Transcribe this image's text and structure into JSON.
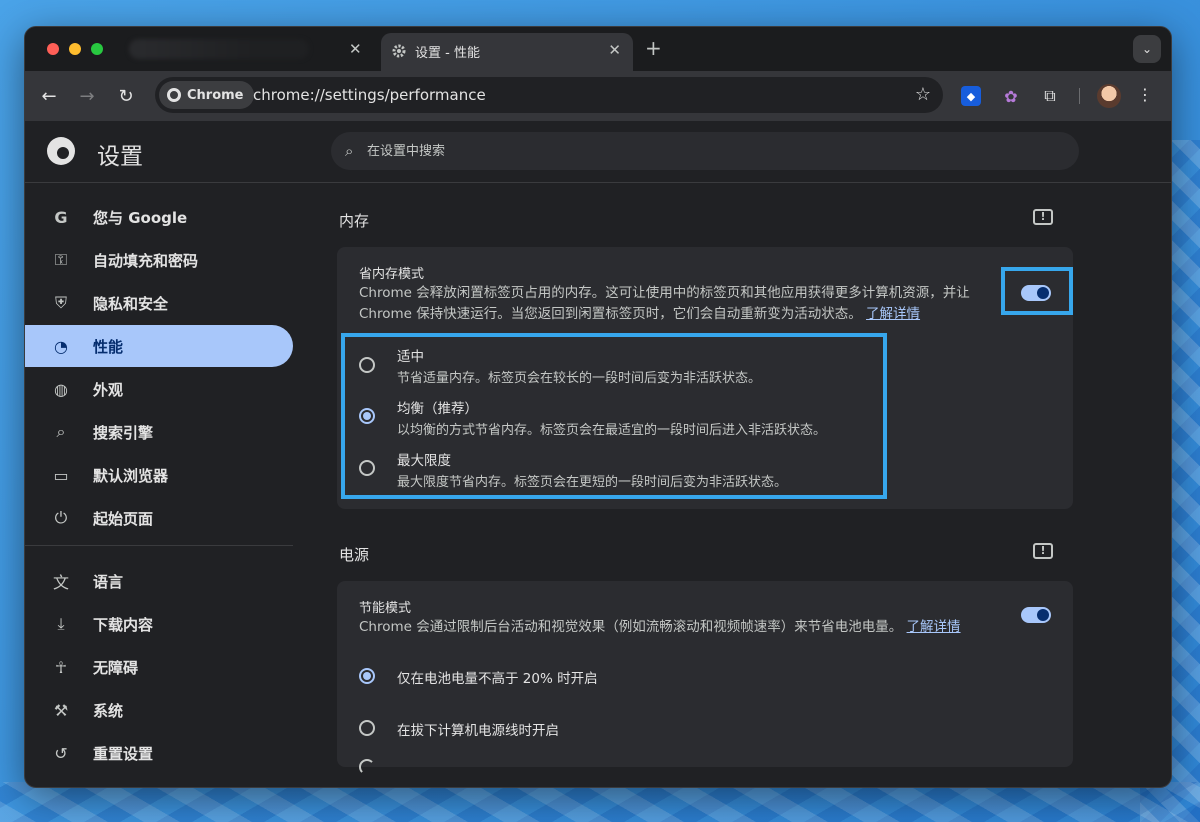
{
  "browser": {
    "active_tab_title": "设置 - 性能",
    "tab_close": "✕",
    "new_tab": "+",
    "tab_menu": "⌄",
    "chip_label": "Chrome",
    "url": "chrome://settings/performance"
  },
  "header": {
    "title": "设置",
    "search_placeholder": "在设置中搜索"
  },
  "sidebar": {
    "items": [
      {
        "label": "您与 Google",
        "icon": "google-icon"
      },
      {
        "label": "自动填充和密码",
        "icon": "key-icon"
      },
      {
        "label": "隐私和安全",
        "icon": "shield-icon"
      },
      {
        "label": "性能",
        "icon": "speedometer-icon",
        "active": true
      },
      {
        "label": "外观",
        "icon": "palette-icon"
      },
      {
        "label": "搜索引擎",
        "icon": "search-icon"
      },
      {
        "label": "默认浏览器",
        "icon": "browser-window-icon"
      },
      {
        "label": "起始页面",
        "icon": "power-icon"
      },
      {
        "label": "语言",
        "icon": "translate-icon"
      },
      {
        "label": "下载内容",
        "icon": "download-icon"
      },
      {
        "label": "无障碍",
        "icon": "accessibility-icon"
      },
      {
        "label": "系统",
        "icon": "wrench-icon"
      },
      {
        "label": "重置设置",
        "icon": "reset-icon"
      }
    ]
  },
  "memory": {
    "section_title": "内存",
    "card_title": "省内存模式",
    "desc_line1": "Chrome 会释放闲置标签页占用的内存。这可让使用中的标签页和其他应用获得更多计算机资源，并让",
    "desc_line2": "Chrome 保持快速运行。当您返回到闲置标签页时，它们会自动重新变为活动状态。",
    "learn_more": "了解详情",
    "toggle_on": true,
    "options": [
      {
        "label": "适中",
        "sub": "节省适量内存。标签页会在较长的一段时间后变为非活跃状态。",
        "checked": false
      },
      {
        "label": "均衡（推荐）",
        "sub": "以均衡的方式节省内存。标签页会在最适宜的一段时间后进入非活跃状态。",
        "checked": true
      },
      {
        "label": "最大限度",
        "sub": "最大限度节省内存。标签页会在更短的一段时间后变为非活跃状态。",
        "checked": false
      }
    ]
  },
  "power": {
    "section_title": "电源",
    "card_title": "节能模式",
    "desc": "Chrome 会通过限制后台活动和视觉效果（例如流畅滚动和视频帧速率）来节省电池电量。",
    "learn_more": "了解详情",
    "toggle_on": true,
    "options": [
      {
        "label": "仅在电池电量不高于 20% 时开启",
        "checked": true
      },
      {
        "label": "在拔下计算机电源线时开启",
        "checked": false
      }
    ]
  },
  "colors": {
    "accent": "#a8c7fa",
    "highlight_box": "#37a7ec",
    "surface": "#2b2c30",
    "background": "#202124"
  }
}
